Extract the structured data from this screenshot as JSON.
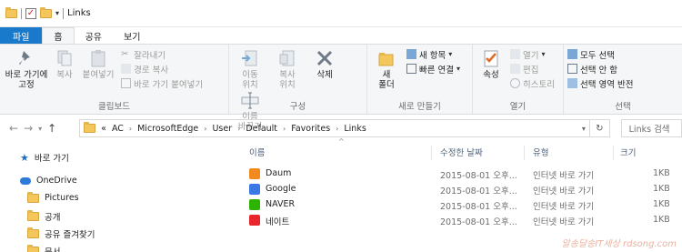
{
  "title": "Links",
  "tabs": [
    {
      "label": "파일"
    },
    {
      "label": "홈"
    },
    {
      "label": "공유"
    },
    {
      "label": "보기"
    }
  ],
  "ribbon": {
    "clipboard": {
      "pin": "바로 가기에\n고정",
      "copy": "복사",
      "paste": "붙여넣기",
      "cut": "잘라내기",
      "copy_path": "경로 복사",
      "paste_shortcut": "바로 가기 붙여넣기",
      "label": "클립보드"
    },
    "organize": {
      "move_to": "이동\n위치",
      "copy_to": "복사\n위치",
      "delete": "삭제",
      "rename": "이름\n바꾸기",
      "label": "구성"
    },
    "new": {
      "new_folder": "새\n폴더",
      "new_item": "새 항목",
      "easy_access": "빠른 연결",
      "label": "새로 만들기"
    },
    "open": {
      "properties": "속성",
      "open": "열기",
      "edit": "편집",
      "history": "히스토리",
      "label": "열기"
    },
    "select": {
      "select_all": "모두 선택",
      "select_none": "선택 안 함",
      "invert": "선택 영역 반전",
      "label": "선택"
    }
  },
  "address": {
    "prefix": "«",
    "crumbs": [
      "AC",
      "MicrosoftEdge",
      "User",
      "Default",
      "Favorites",
      "Links"
    ],
    "search_placeholder": "Links 검색"
  },
  "navpane": {
    "quick_access": "바로 가기",
    "onedrive": "OneDrive",
    "items": [
      "Pictures",
      "공개",
      "공유 즐겨찾기",
      "문서"
    ]
  },
  "columns": {
    "name": "이름",
    "date": "수정한 날짜",
    "type": "유형",
    "size": "크기"
  },
  "files": [
    {
      "name": "Daum",
      "date": "2015-08-01 오후...",
      "type": "인터넷 바로 가기",
      "size": "1KB",
      "icon_color": "#f28a1d"
    },
    {
      "name": "Google",
      "date": "2015-08-01 오후...",
      "type": "인터넷 바로 가기",
      "size": "1KB",
      "icon_color": "#3b78e7"
    },
    {
      "name": "NAVER",
      "date": "2015-08-01 오후...",
      "type": "인터넷 바로 가기",
      "size": "1KB",
      "icon_color": "#2db400"
    },
    {
      "name": "네이트",
      "date": "2015-08-01 오후...",
      "type": "인터넷 바로 가기",
      "size": "1KB",
      "icon_color": "#e8262b"
    }
  ],
  "watermark": "알송달송IT세상 rdsong.com"
}
